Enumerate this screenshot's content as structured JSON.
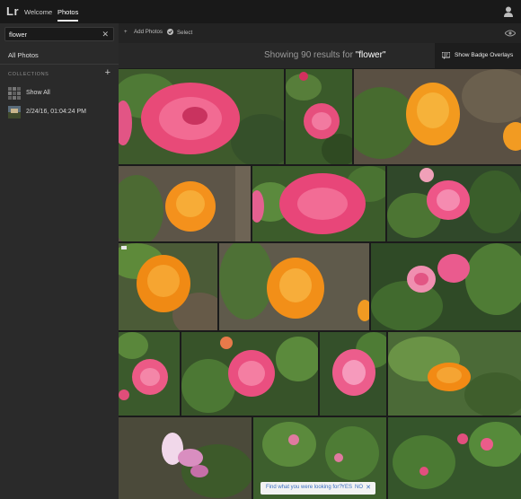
{
  "app": {
    "logo": "Lr"
  },
  "nav": {
    "tabs": [
      {
        "label": "Welcome"
      },
      {
        "label": "Photos"
      }
    ]
  },
  "search": {
    "value": "flower"
  },
  "sidebar": {
    "all_photos": "All Photos",
    "collections_header": "COLLECTIONS",
    "collections": [
      {
        "label": "Show All"
      },
      {
        "label": "2/24/16, 01:04:24 PM"
      }
    ]
  },
  "toolbar": {
    "add_photos": "Add Photos",
    "select": "Select"
  },
  "results": {
    "prefix": "Showing 90 results for ",
    "query": "\"flower\""
  },
  "badge_overlays": "Show Badge Overlays",
  "photos": [
    {
      "subject": "pink camellia"
    },
    {
      "subject": "pink camellia"
    },
    {
      "subject": "orange poppy"
    },
    {
      "subject": "orange poppy"
    },
    {
      "subject": "pink camellia"
    },
    {
      "subject": "pink camellia"
    },
    {
      "subject": "orange poppy"
    },
    {
      "subject": "orange poppy"
    },
    {
      "subject": "pink camellia buds"
    },
    {
      "subject": "pink camellia"
    },
    {
      "subject": "pink camellia"
    },
    {
      "subject": "pink camellia"
    },
    {
      "subject": "orange poppy"
    },
    {
      "subject": "magnolia"
    },
    {
      "subject": "camellia bush"
    },
    {
      "subject": "camellia bush"
    }
  ],
  "feedback": {
    "question": "Find what you were looking for?",
    "yes": "YES",
    "no": "NO"
  },
  "colors": {
    "accent": "#ffffff",
    "background": "#1e1e1e",
    "link": "#3a6fc0"
  }
}
